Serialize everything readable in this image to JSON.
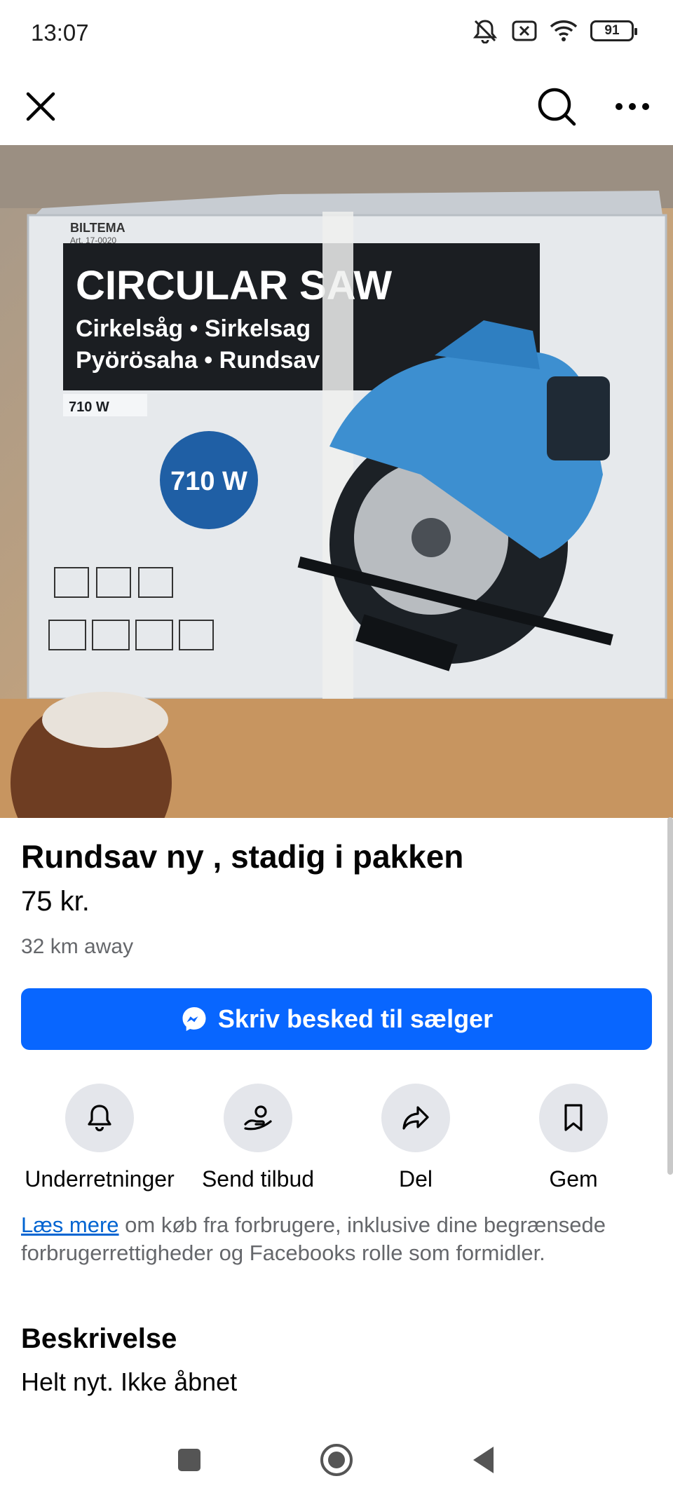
{
  "status_bar": {
    "time": "13:07",
    "battery": "91",
    "icons": [
      "mute-icon",
      "sim-off-icon",
      "wifi-icon",
      "battery-icon"
    ]
  },
  "app_bar": {
    "icons": [
      "close-icon",
      "search-icon",
      "more-icon"
    ]
  },
  "product_image": {
    "box_brand": "BILTEMA",
    "box_article": "Art. 17-0020",
    "box_title": "CIRCULAR SAW",
    "box_line2": "Cirkelsåg • Sirkelsag",
    "box_line3": "Pyörösaha • Rundsav",
    "box_watt_small": "710 W",
    "box_watt_badge": "710 W"
  },
  "listing": {
    "title": "Rundsav ny , stadig i pakken",
    "price": "75 kr.",
    "distance": "32 km away",
    "message_button": "Skriv besked til sælger"
  },
  "actions": [
    {
      "label": "Underretninger",
      "icon": "bell-icon"
    },
    {
      "label": "Send tilbud",
      "icon": "offer-icon"
    },
    {
      "label": "Del",
      "icon": "share-icon"
    },
    {
      "label": "Gem",
      "icon": "bookmark-icon"
    }
  ],
  "info": {
    "link": "Læs mere",
    "text": " om køb fra forbrugere, inklusive dine begrænsede forbrugerrettigheder og Facebooks rolle som formidler."
  },
  "description": {
    "heading": "Beskrivelse",
    "text": "Helt nyt. Ikke åbnet"
  },
  "colors": {
    "accent": "#0866ff",
    "link": "#0064d1",
    "secondary_text": "#65676b",
    "action_circle": "#e4e6eb"
  }
}
